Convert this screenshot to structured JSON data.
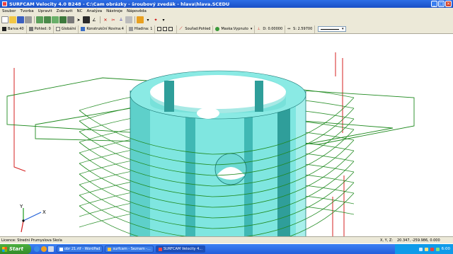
{
  "window": {
    "title": "SURFCAM Velocity 4.0 B248 - C:\\Cam obrázky - šroubový zvedák - hlava\\hlava.SCEDU",
    "buttons": {
      "minimize": "_",
      "maximize": "□",
      "close": "×"
    }
  },
  "menu": [
    "Soubor",
    "Tvorba",
    "Upravit",
    "Zobrazit",
    "NC",
    "Analýza",
    "Nástroje",
    "Nápověda"
  ],
  "status": {
    "barva": "Barva:40",
    "pohled": "Pohled: 0",
    "globalni": "Globální",
    "rovina": "Konstrukční Rovina:4",
    "hladina": "Hladina: 1",
    "soufad": "Souřad:Pohled",
    "maska": "Maska:Vypnuto",
    "d": "D: 0.00000",
    "s": "S: 2.59700"
  },
  "viewport": {
    "triad_x": "X",
    "triad_y": "Y",
    "colors": {
      "cylinder": "#7fe6e0",
      "cylinder_dark": "#30a3a0",
      "helix": "#1f8a1f",
      "box": "#d42020"
    }
  },
  "info": {
    "license": "Licence: Stredni Prumyslova Skola",
    "xyz_label": "X, Y, Z:",
    "coords": "20.347, -259.986, 0.000"
  },
  "taskbar": {
    "start": "Start",
    "items": [
      "obr 21.rtf - WordPad",
      "surfcam - Seznam -...",
      "SURFCAM Velocity 4..."
    ],
    "clock": "6:00"
  }
}
